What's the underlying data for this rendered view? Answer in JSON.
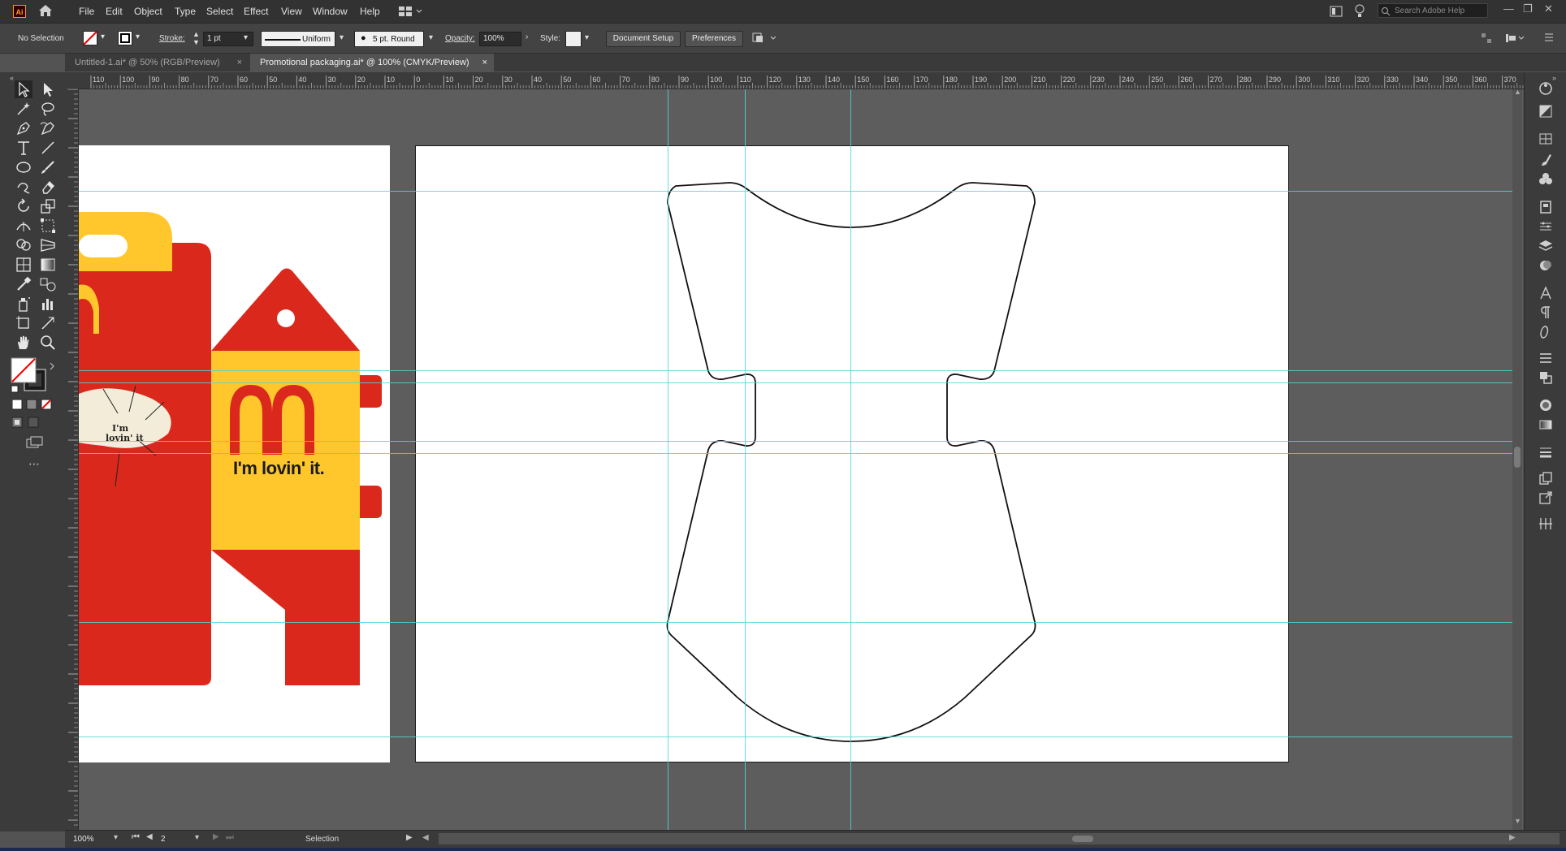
{
  "menubar": {
    "app_logo": "Ai",
    "items": [
      "File",
      "Edit",
      "Object",
      "Type",
      "Select",
      "Effect",
      "View",
      "Window",
      "Help"
    ],
    "search_placeholder": "Search Adobe Help"
  },
  "control_bar": {
    "selection_label": "No Selection",
    "stroke_label": "Stroke:",
    "stroke_value": "1 pt",
    "profile_value": "Uniform",
    "brush_value": "5 pt. Round",
    "opacity_label": "Opacity:",
    "opacity_value": "100%",
    "style_label": "Style:",
    "document_setup_label": "Document Setup",
    "preferences_label": "Preferences"
  },
  "tabs": [
    {
      "label": "Untitled-1.ai* @ 50% (RGB/Preview)",
      "active": false
    },
    {
      "label": "Promotional packaging.ai* @ 100% (CMYK/Preview)",
      "active": true
    }
  ],
  "ruler_h_labels": [
    "110",
    "100",
    "90",
    "80",
    "70",
    "60",
    "50",
    "40",
    "30",
    "20",
    "10",
    "0",
    "10",
    "20",
    "30",
    "40",
    "50",
    "60",
    "70",
    "80",
    "90",
    "100",
    "110",
    "120",
    "130",
    "140",
    "150",
    "160",
    "170",
    "180",
    "190",
    "200",
    "210",
    "220",
    "230",
    "240",
    "250",
    "260",
    "270",
    "280",
    "290",
    "300",
    "310",
    "320",
    "330",
    "340",
    "350",
    "360",
    "370"
  ],
  "artwork": {
    "tagline": "I'm lovin' it.",
    "bubble_text_1": "I'm",
    "bubble_text_2": "lovin' it"
  },
  "statusbar": {
    "zoom_value": "100%",
    "artboard_number": "2",
    "mode_label": "Selection"
  },
  "colors": {
    "mcd_red": "#da291c",
    "mcd_yellow": "#ffc72c",
    "guide": "#4fd6d6"
  }
}
